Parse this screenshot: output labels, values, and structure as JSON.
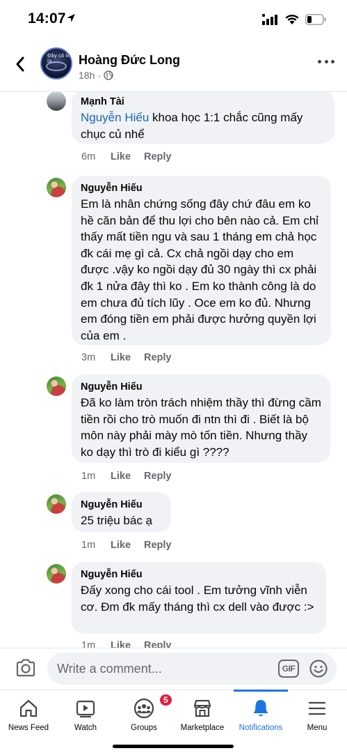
{
  "status_bar": {
    "time": "14:07"
  },
  "header": {
    "post_author": "Hoàng Đức Long",
    "timestamp": "18h",
    "avatar_caption": "Đây có lẽ là..."
  },
  "comments": [
    {
      "author": "Mạnh Tài",
      "mention": "Nguyễn Hiếu",
      "text": " khoa học 1:1 chắc cũng mấy chục củ nhể",
      "time": "6m",
      "like_label": "Like",
      "reply_label": "Reply"
    },
    {
      "author": "Nguyễn Hiếu",
      "text": "Em là nhân chứng sống đây chứ đâu em ko hề căn bản để thu lợi cho bên nào cả. Em chỉ thấy mất tiền ngu và sau 1 tháng em chả học đk cái mẹ gì cả. Cx chả ngồi dạy cho em được .vậy ko ngồi dạy đủ 30 ngày thì cx phải đk 1 nửa đây thì ko . Em ko thành công là do em chưa đủ tích lũy . Oce em ko đủ. Nhưng em đóng tiền em phải được hưởng quyền lợi của em .",
      "time": "3m",
      "like_label": "Like",
      "reply_label": "Reply"
    },
    {
      "author": "Nguyễn Hiếu",
      "text": "Đã ko làm tròn trách nhiệm thầy thì đừng cầm tiền rồi cho trò muốn đi ntn thì đi . Biết là bộ môn này phải mày mò tốn tiền. Nhưng thầy ko dạy thì trò đi kiểu gì ????",
      "time": "1m",
      "like_label": "Like",
      "reply_label": "Reply"
    },
    {
      "author": "Nguyễn Hiếu",
      "text": "25 triệu bác ạ",
      "time": "1m",
      "like_label": "Like",
      "reply_label": "Reply"
    },
    {
      "author": "Nguyễn Hiếu",
      "text": "Đấy xong cho cái tool . Em tưởng vĩnh viễn cơ. Đm đk mấy tháng thì cx dell vào được :>",
      "time": "1m",
      "like_label": "Like",
      "reply_label": "Reply"
    }
  ],
  "composer": {
    "placeholder": "Write a comment...",
    "gif_label": "GIF"
  },
  "bottom_nav": {
    "items": [
      {
        "label": "News Feed",
        "icon": "home-icon"
      },
      {
        "label": "Watch",
        "icon": "watch-icon"
      },
      {
        "label": "Groups",
        "icon": "groups-icon",
        "badge": "5"
      },
      {
        "label": "Marketplace",
        "icon": "marketplace-icon"
      },
      {
        "label": "Notifications",
        "icon": "bell-icon",
        "active": true
      },
      {
        "label": "Menu",
        "icon": "menu-icon"
      }
    ]
  },
  "colors": {
    "accent": "#1b74e4",
    "mention": "#1b66b8",
    "badge": "#e41e3f",
    "bubble": "#f0f2f5"
  }
}
